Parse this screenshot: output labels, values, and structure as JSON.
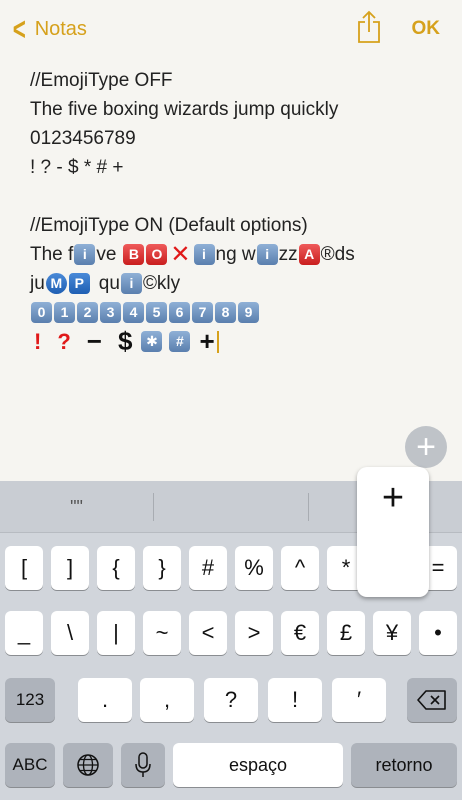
{
  "nav": {
    "back_label": "Notas",
    "done_label": "OK",
    "back_icon": "chevron-left-icon",
    "share_icon": "share-icon",
    "accent_color": "#d6a11c"
  },
  "note": {
    "line1": "//EmojiType OFF",
    "line2": "The five boxing wizards jump quickly",
    "line3": "0123456789",
    "line4": "! ? - $ * # +",
    "line5": "//EmojiType ON (Default options)",
    "line6": {
      "t1": "The f",
      "t2": "ve",
      "b": "B",
      "o": "O",
      "x": "✕",
      "i3": "i",
      "t3": "ng w",
      "i4": "i",
      "t4": "zz",
      "a": "A",
      "t5": "®ds"
    },
    "line7": {
      "t1": "ju",
      "m": "M",
      "p": "P",
      "t2": "qu",
      "i": "i",
      "t3": "©kly"
    },
    "line8_digits": [
      "0",
      "1",
      "2",
      "3",
      "4",
      "5",
      "6",
      "7",
      "8",
      "9"
    ],
    "line9": {
      "excl": "!",
      "quest": "?",
      "minus": "−",
      "dollar": "$",
      "star": "✱",
      "hash": "#",
      "plus": "+"
    }
  },
  "add_button": "+",
  "keyboard": {
    "suggestion": "\"\"",
    "row1": [
      "[",
      "]",
      "{",
      "}",
      "#",
      "%",
      "^",
      "*",
      "+",
      "="
    ],
    "row2": [
      "_",
      "\\",
      "|",
      "~",
      "<",
      ">",
      "€",
      "£",
      "¥",
      "•"
    ],
    "row3_mode": "123",
    "row3": [
      ".",
      ",",
      "?",
      "!",
      "′"
    ],
    "delete_icon": "backspace-icon",
    "mode_abc": "ABC",
    "globe_icon": "globe-icon",
    "mic_icon": "microphone-icon",
    "space": "espaço",
    "return": "retorno",
    "popup_key": "+"
  }
}
